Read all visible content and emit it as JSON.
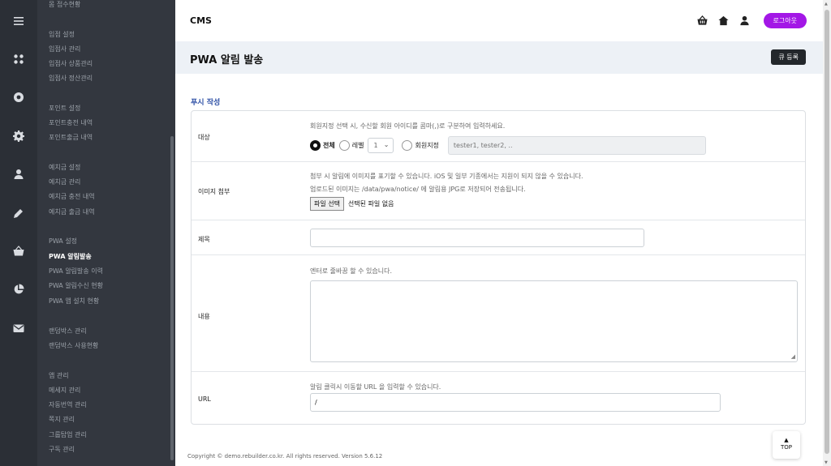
{
  "rail": {
    "icons": [
      "menu-icon",
      "apps-icon",
      "settings-circle-icon",
      "gear-icon",
      "user-icon",
      "edit-icon",
      "basket-icon",
      "pie-chart-icon",
      "mail-icon"
    ]
  },
  "submenu": {
    "items": [
      {
        "label": "몸 접수현황",
        "active": false
      },
      {
        "label": "입점 설정",
        "active": false
      },
      {
        "label": "입점사 관리",
        "active": false
      },
      {
        "label": "입점사 상품관리",
        "active": false
      },
      {
        "label": "입점사 정산관리",
        "active": false
      },
      {
        "label": "포인트 설정",
        "active": false
      },
      {
        "label": "포인트충전 내역",
        "active": false
      },
      {
        "label": "포인트출금 내역",
        "active": false
      },
      {
        "label": "예치금 설정",
        "active": false
      },
      {
        "label": "예치금 관리",
        "active": false
      },
      {
        "label": "예치금 충전 내역",
        "active": false
      },
      {
        "label": "예치금 출금 내역",
        "active": false
      },
      {
        "label": "PWA 설정",
        "active": false
      },
      {
        "label": "PWA 알림발송",
        "active": true
      },
      {
        "label": "PWA 알림발송 이력",
        "active": false
      },
      {
        "label": "PWA 알림수신 현황",
        "active": false
      },
      {
        "label": "PWA 앱 설치 현황",
        "active": false
      },
      {
        "label": "랜덤박스 관리",
        "active": false
      },
      {
        "label": "랜덤박스 사용현황",
        "active": false
      },
      {
        "label": "앱 관리",
        "active": false
      },
      {
        "label": "메세지 관리",
        "active": false
      },
      {
        "label": "자동번역 관리",
        "active": false
      },
      {
        "label": "쪽지 관리",
        "active": false
      },
      {
        "label": "그룹탑업 관리",
        "active": false
      },
      {
        "label": "구독 관리",
        "active": false
      }
    ]
  },
  "header": {
    "brand": "CMS",
    "icons": [
      "basket-icon",
      "home-icon",
      "user-icon"
    ],
    "logout_label": "로그아웃"
  },
  "page": {
    "title": "PWA 알림 발송",
    "queue_button": "큐 등록",
    "section_title": "푸시 작성"
  },
  "form": {
    "target": {
      "label": "대상",
      "help": "회원지정 선택 시, 수신할 회원 아이디를 콤마(,)로 구분하여 입력하세요.",
      "options": {
        "all": "전체",
        "level": "레벨",
        "member": "회원지정"
      },
      "selected": "all",
      "level_value": "1",
      "member_placeholder": "tester1, tester2, .."
    },
    "image": {
      "label": "이미지 첨부",
      "help1": "첨부 시 알림에 이미지를 표기할 수 있습니다. iOS 및 일부 기종에서는 지원이 되지 않을 수 있습니다.",
      "help2": "업로드된 이미지는 /data/pwa/notice/ 에 알림용 JPG로 저장되어 전송됩니다.",
      "choose_label": "파일 선택",
      "no_file": "선택된 파일 없음"
    },
    "subject": {
      "label": "제목",
      "value": ""
    },
    "content": {
      "label": "내용",
      "help": "엔터로 줄바꿈 할 수 있습니다.",
      "value": ""
    },
    "url": {
      "label": "URL",
      "help": "알림 클릭시 이동할 URL 을 입력할 수 있습니다.",
      "value": "/"
    }
  },
  "footer": {
    "text": "Copyright © demo.rebuilder.co.kr. All rights reserved. Version 5.6.12"
  },
  "top_button": {
    "label": "TOP"
  },
  "colors": {
    "rail_bg": "#2b2f36",
    "submenu_bg": "#33373f",
    "accent_purple": "#a317e6",
    "section_blue": "#2f51a6",
    "titlebar_bg": "#edf1f6"
  }
}
